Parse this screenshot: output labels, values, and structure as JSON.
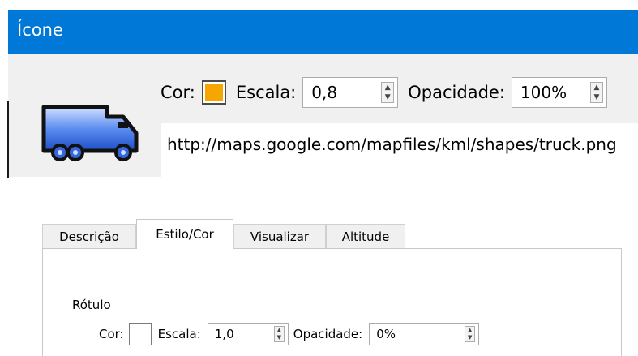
{
  "icon_panel": {
    "title": "Ícone",
    "color_label": "Cor:",
    "color_value": "#f7a600",
    "scale_label": "Escala:",
    "scale_value": "0,8",
    "opacity_label": "Opacidade:",
    "opacity_value": "100%",
    "icon_url": "http://maps.google.com/mapfiles/kml/shapes/truck.png",
    "icon_name": "truck-icon"
  },
  "tabs": [
    {
      "label": "Descrição"
    },
    {
      "label": "Estilo/Cor"
    },
    {
      "label": "Visualizar"
    },
    {
      "label": "Altitude"
    }
  ],
  "active_tab": "Estilo/Cor",
  "label_group": {
    "title": "Rótulo",
    "color_label": "Cor:",
    "color_value": "#ffffff",
    "scale_label": "Escala:",
    "scale_value": "1,0",
    "opacity_label": "Opacidade:",
    "opacity_value": "0%"
  },
  "colors": {
    "titlebar": "#0078d7",
    "panel_bg": "#f0f0f0"
  }
}
